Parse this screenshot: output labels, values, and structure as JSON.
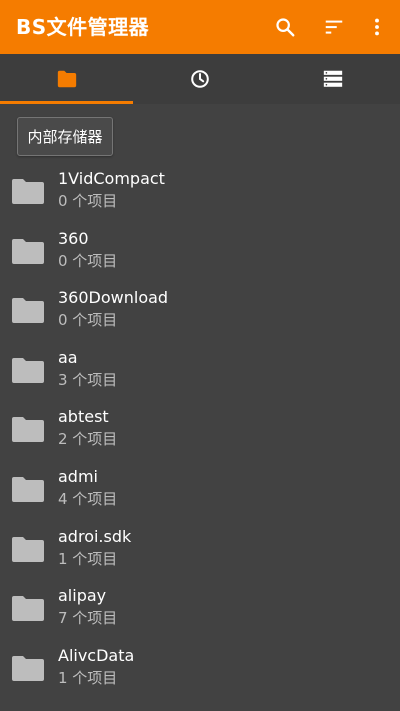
{
  "app": {
    "title": "BS文件管理器",
    "accent_color": "#F57C00",
    "background_color": "#424242"
  },
  "toolbar": {
    "actions": [
      {
        "icon": "search-icon"
      },
      {
        "icon": "sort-icon"
      },
      {
        "icon": "more-vert-icon"
      }
    ]
  },
  "tabs": [
    {
      "icon": "folder-icon",
      "selected": true
    },
    {
      "icon": "history-icon",
      "selected": false
    },
    {
      "icon": "storage-icon",
      "selected": false
    }
  ],
  "storage": {
    "label": "内部存储器"
  },
  "files": [
    {
      "name": "1VidCompact",
      "count": "0 个项目"
    },
    {
      "name": "360",
      "count": "0 个项目"
    },
    {
      "name": "360Download",
      "count": "0 个项目"
    },
    {
      "name": "aa",
      "count": "3 个项目"
    },
    {
      "name": "abtest",
      "count": "2 个项目"
    },
    {
      "name": "admi",
      "count": "4 个项目"
    },
    {
      "name": "adroi.sdk",
      "count": "1 个项目"
    },
    {
      "name": "alipay",
      "count": "7 个项目"
    },
    {
      "name": "AlivcData",
      "count": "1 个项目"
    }
  ]
}
